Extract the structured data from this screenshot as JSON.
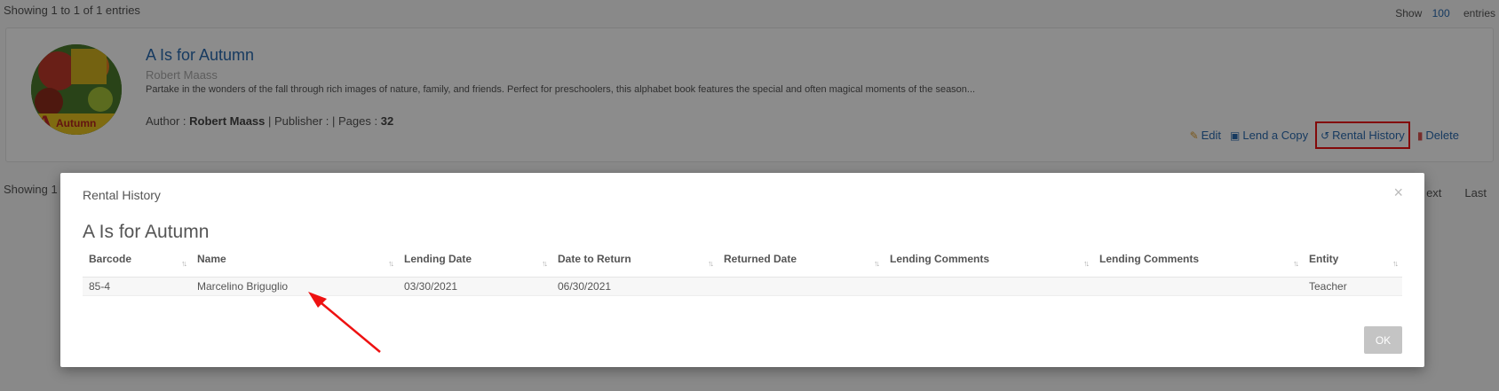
{
  "list": {
    "top_info": "Showing 1 to 1 of 1 entries",
    "show_label": "Show",
    "show_value": "100",
    "entries_label": "entries",
    "bottom_info": "Showing 1",
    "pager": [
      "ext",
      "Last"
    ]
  },
  "book": {
    "title": "A Is for Autumn",
    "author_sub": "Robert Maass",
    "description": "Partake in the wonders of the fall through rich images of nature, family, and friends. Perfect for preschoolers, this alphabet book features the special and often magical moments of the season...",
    "meta_author_label": "Author : ",
    "meta_author": "Robert Maass",
    "meta_publisher_label": " | Publisher : | Pages : ",
    "meta_pages": "32",
    "actions": {
      "edit": "Edit",
      "lend": "Lend a Copy",
      "rental_history": "Rental History",
      "delete": "Delete"
    }
  },
  "modal": {
    "header": "Rental History",
    "close": "×",
    "book_title": "A Is for Autumn",
    "columns": [
      "Barcode",
      "Name",
      "Lending Date",
      "Date to Return",
      "Returned Date",
      "Lending Comments",
      "Lending Comments",
      "Entity"
    ],
    "rows": [
      [
        "85-4",
        "Marcelino Briguglio",
        "03/30/2021",
        "06/30/2021",
        "",
        "",
        "",
        "Teacher"
      ]
    ],
    "ok": "OK"
  },
  "colors": {
    "link": "#2a6bb0",
    "highlight": "#ee1111",
    "arrow": "#ee1111"
  }
}
